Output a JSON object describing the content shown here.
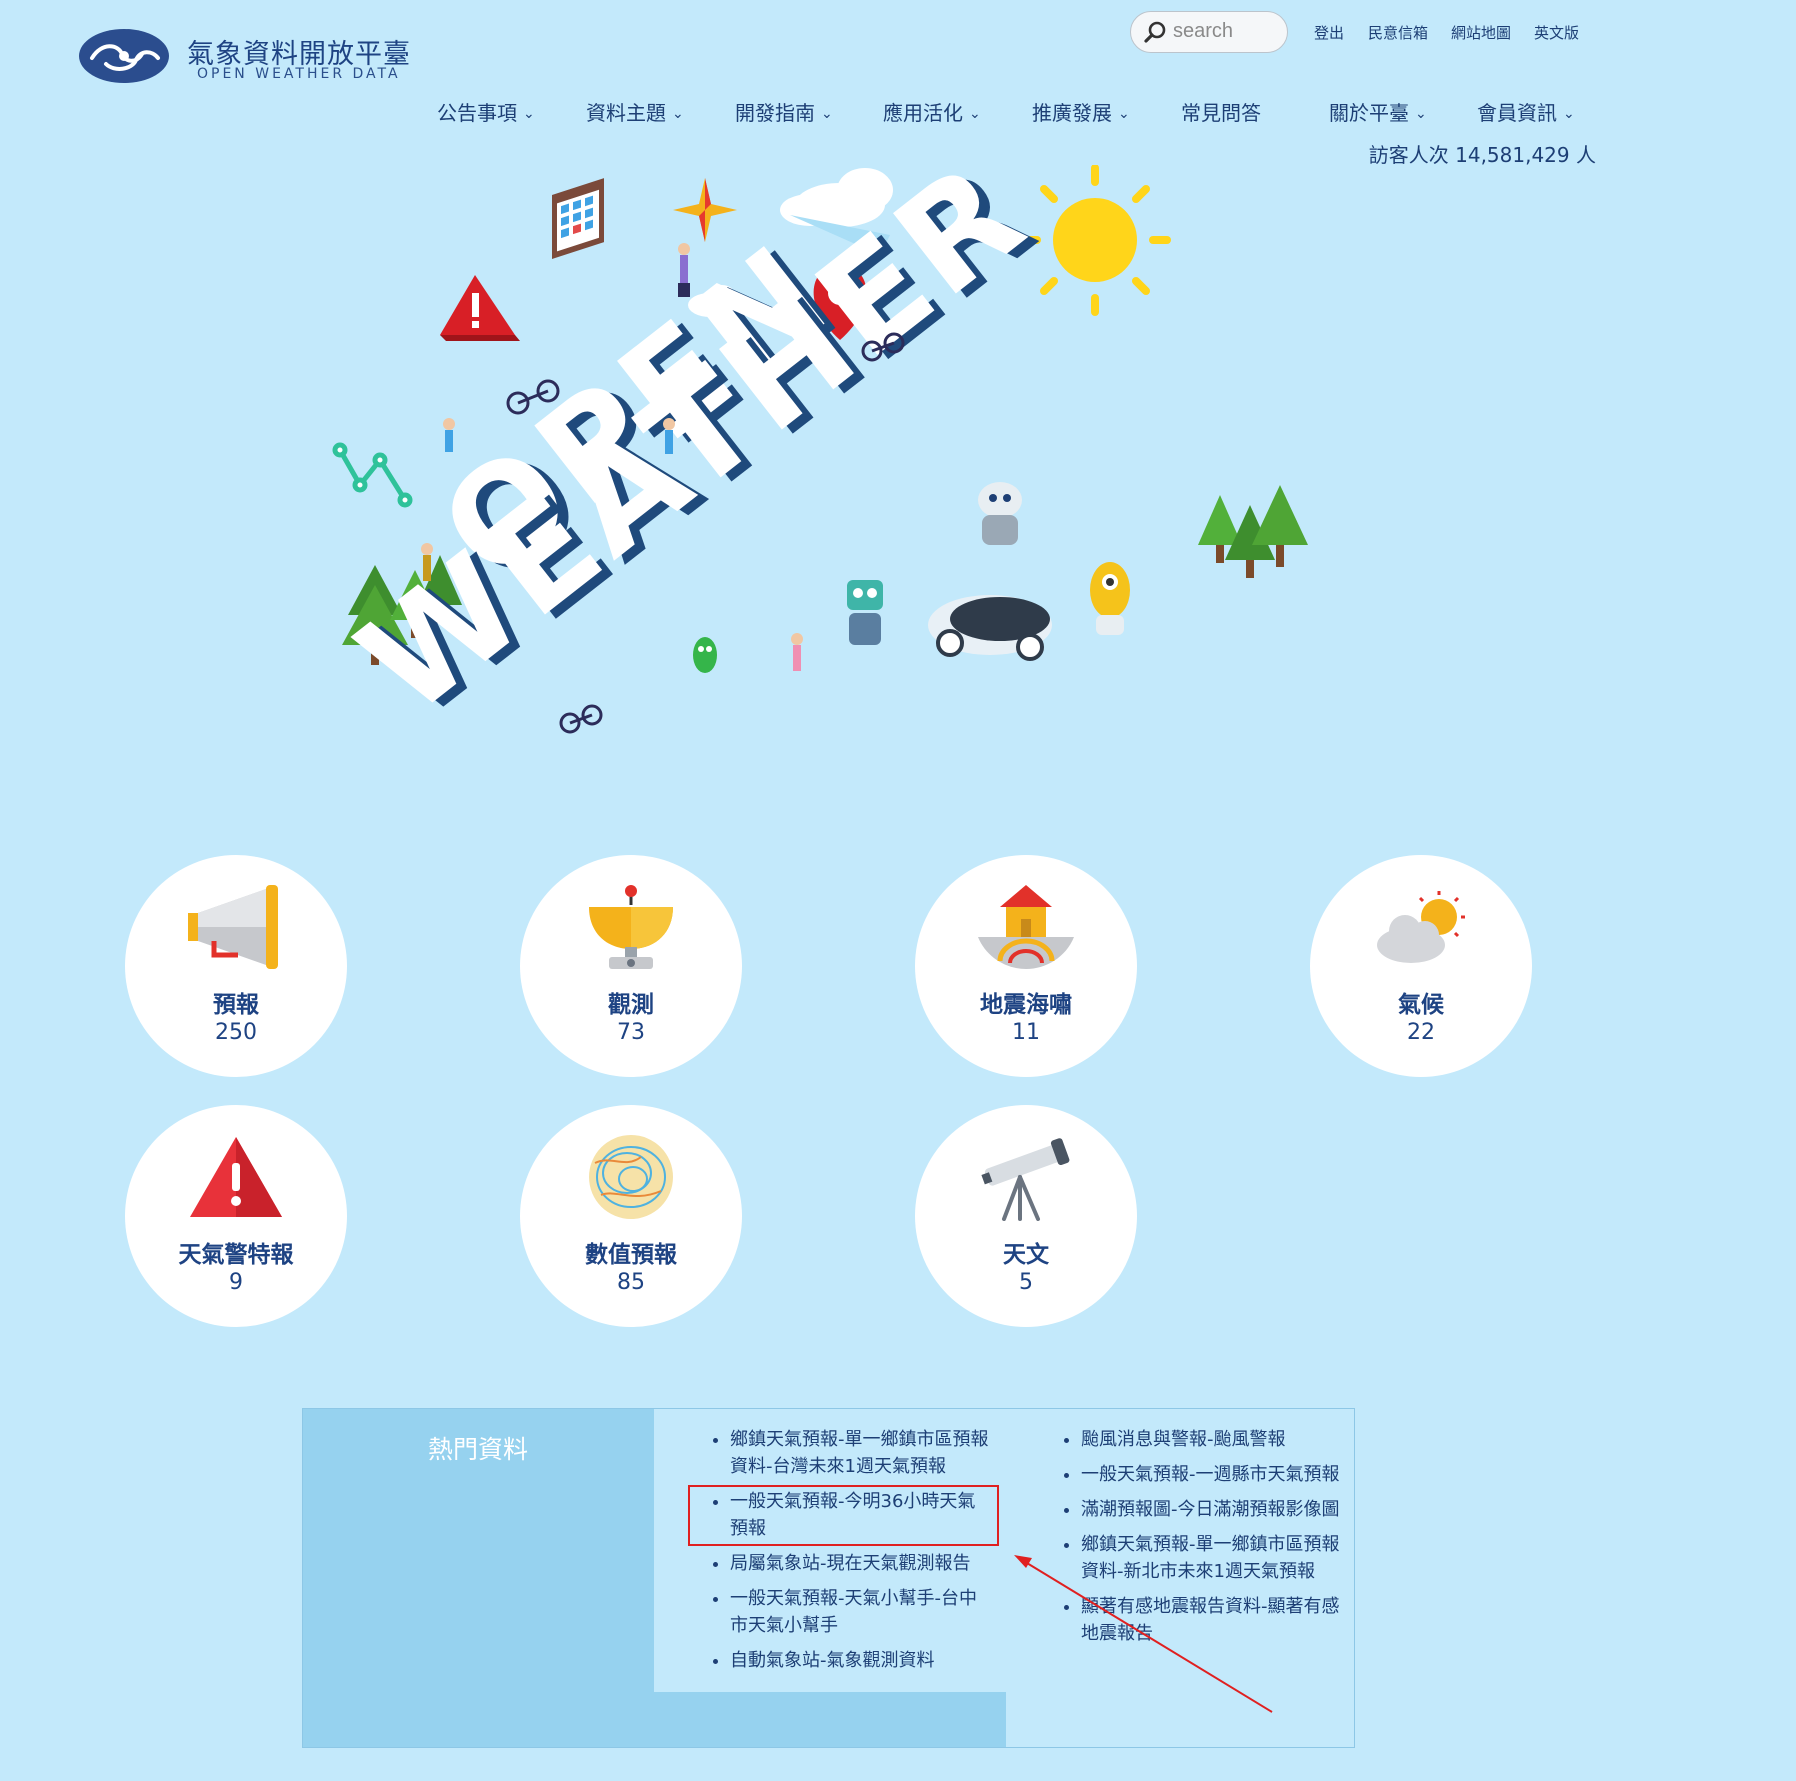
{
  "logo": {
    "title": "氣象資料開放平臺",
    "subtitle": "OPEN WEATHER DATA"
  },
  "search": {
    "placeholder": "search"
  },
  "util_links": [
    "登出",
    "民意信箱",
    "網站地圖",
    "英文版"
  ],
  "nav": [
    {
      "label": "公告事項",
      "dropdown": true
    },
    {
      "label": "資料主題",
      "dropdown": true
    },
    {
      "label": "開發指南",
      "dropdown": true
    },
    {
      "label": "應用活化",
      "dropdown": true
    },
    {
      "label": "推廣發展",
      "dropdown": true
    },
    {
      "label": "常見問答",
      "dropdown": false
    },
    {
      "label": "關於平臺",
      "dropdown": true
    },
    {
      "label": "會員資訊",
      "dropdown": true
    }
  ],
  "visitor": "訪客人次 14,581,429 人",
  "categories": [
    {
      "label": "預報",
      "count": "250",
      "icon": "megaphone-icon"
    },
    {
      "label": "觀測",
      "count": "73",
      "icon": "radar-dish-icon"
    },
    {
      "label": "地震海嘯",
      "count": "11",
      "icon": "earthquake-house-icon"
    },
    {
      "label": "氣候",
      "count": "22",
      "icon": "cloud-sun-icon"
    },
    {
      "label": "天氣警特報",
      "count": "9",
      "icon": "warning-triangle-icon"
    },
    {
      "label": "數值預報",
      "count": "85",
      "icon": "weather-map-icon"
    },
    {
      "label": "天文",
      "count": "5",
      "icon": "telescope-icon"
    }
  ],
  "popular": {
    "title": "熱門資料",
    "col1": [
      "鄉鎮天氣預報-單一鄉鎮市區預報資料-台灣未來1週天氣預報",
      "一般天氣預報-今明36小時天氣預報",
      "局屬氣象站-現在天氣觀測報告",
      "一般天氣預報-天氣小幫手-台中市天氣小幫手",
      "自動氣象站-氣象觀測資料"
    ],
    "col2": [
      "颱風消息與警報-颱風警報",
      "一般天氣預報-一週縣市天氣預報",
      "滿潮預報圖-今日滿潮預報影像圖",
      "鄉鎮天氣預報-單一鄉鎮市區預報資料-新北市未來1週天氣預報",
      "顯著有感地震報告資料-顯著有感地震報告"
    ]
  },
  "colors": {
    "background": "#c3e9fb",
    "text": "#1d3f75",
    "panel": "#96d2ef",
    "highlight": "#e02020"
  }
}
